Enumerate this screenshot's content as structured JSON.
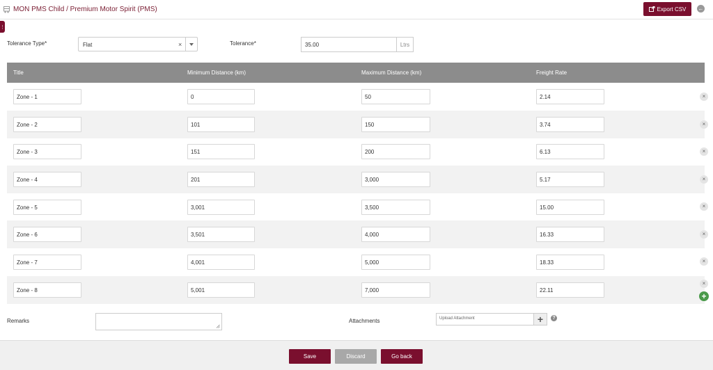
{
  "header": {
    "title": "MON PMS Child / Premium Motor Spirit (PMS)",
    "export_label": "Export CSV"
  },
  "form": {
    "tolerance_type_label": "Tolerance Type*",
    "tolerance_type_value": "Flat",
    "tolerance_label": "Tolerance*",
    "tolerance_value": "35.00",
    "tolerance_unit": "Ltrs"
  },
  "table": {
    "columns": [
      "Title",
      "Minimum Distance (km)",
      "Maximum Distance (km)",
      "Freight Rate"
    ],
    "rows": [
      {
        "title": "Zone - 1",
        "min": "0",
        "max": "50",
        "rate": "2.14"
      },
      {
        "title": "Zone - 2",
        "min": "101",
        "max": "150",
        "rate": "3.74"
      },
      {
        "title": "Zone - 3",
        "min": "151",
        "max": "200",
        "rate": "6.13"
      },
      {
        "title": "Zone - 4",
        "min": "201",
        "max": "3,000",
        "rate": "5.17"
      },
      {
        "title": "Zone - 5",
        "min": "3,001",
        "max": "3,500",
        "rate": "15.00"
      },
      {
        "title": "Zone - 6",
        "min": "3,501",
        "max": "4,000",
        "rate": "16.33"
      },
      {
        "title": "Zone - 7",
        "min": "4,001",
        "max": "5,000",
        "rate": "18.33"
      },
      {
        "title": "Zone - 8",
        "min": "5,001",
        "max": "7,000",
        "rate": "22.11"
      }
    ]
  },
  "bottom": {
    "remarks_label": "Remarks",
    "attachments_label": "Attachments",
    "upload_placeholder": "Upload Attachment"
  },
  "footer": {
    "save_label": "Save",
    "discard_label": "Discard",
    "goback_label": "Go back"
  },
  "colors": {
    "brand": "#7a0f2e",
    "table_header": "#8c8c8c",
    "add_green": "#4a9a4a"
  },
  "icons": {
    "header": "truck-icon",
    "export": "export-icon",
    "back": "back-arrow-icon",
    "side": "menu-dots-icon",
    "remove": "close-icon",
    "add": "plus-icon",
    "upload": "plus-icon",
    "help": "help-icon"
  }
}
